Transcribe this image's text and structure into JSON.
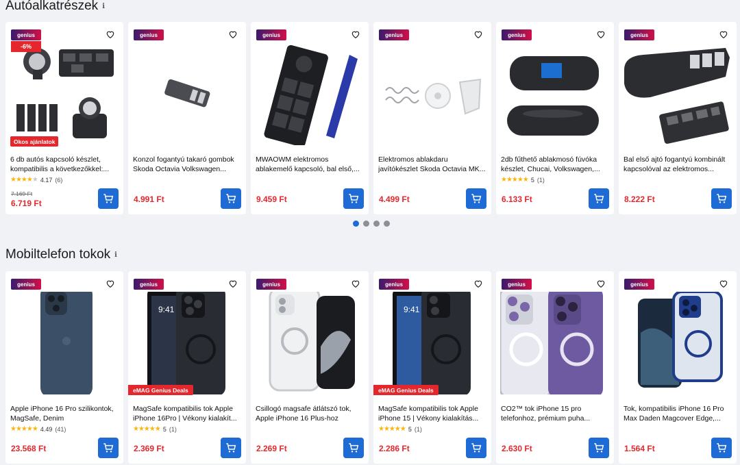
{
  "sections": [
    {
      "title": "Autóalkatrészek",
      "products": [
        {
          "badge": "genius",
          "discount": "-6%",
          "tag": "Okos ajánlatok",
          "title": "6 db autós kapcsoló készlet, kompatibilis a következőkkel:...",
          "stars": 4,
          "rating": "4.17",
          "reviews": "(6)",
          "old_price": "7.169 Ft",
          "price": "6.719 Ft",
          "image": "switch-set"
        },
        {
          "badge": "genius",
          "title": "Konzol fogantyú takaró gombok Skoda Octavia Volkswagen...",
          "price": "4.991 Ft",
          "image": "console-button"
        },
        {
          "badge": "genius",
          "title": "MWAOWM elektromos ablakemelő kapcsoló, bal első,...",
          "price": "9.459 Ft",
          "image": "window-switch"
        },
        {
          "badge": "genius",
          "title": "Elektromos ablakdaru javítókészlet Skoda Octavia MK...",
          "price": "4.499 Ft",
          "image": "repair-kit"
        },
        {
          "badge": "genius",
          "title": "2db fűthető ablakmosó fúvóka készlet, Chucai, Volkswagen,...",
          "stars": 5,
          "rating": "5",
          "reviews": "(1)",
          "price": "6.133 Ft",
          "image": "nozzle"
        },
        {
          "badge": "genius",
          "title": "Bal első ajtó fogantyú kombinált kapcsolóval az elektromos...",
          "price": "8.222 Ft",
          "image": "door-handle"
        }
      ]
    },
    {
      "title": "Mobiltelefon tokok",
      "products": [
        {
          "badge": "genius",
          "title": "Apple iPhone 16 Pro szilikontok, MagSafe, Denim",
          "stars": 4.5,
          "rating": "4.49",
          "reviews": "(41)",
          "price": "23.568 Ft",
          "image": "silicone-case"
        },
        {
          "badge": "genius",
          "tag": "eMAG Genius Deals",
          "title": "MagSafe kompatibilis tok Apple iPhone 16Pro | Vékony kialakít...",
          "stars": 5,
          "rating": "5",
          "reviews": "(1)",
          "price": "2.369 Ft",
          "image": "dark-case"
        },
        {
          "badge": "genius",
          "title": "Csillogó magsafe átlátszó tok, Apple iPhone 16 Plus-hoz",
          "price": "2.269 Ft",
          "image": "clear-case"
        },
        {
          "badge": "genius",
          "tag": "eMAG Genius Deals",
          "title": "MagSafe kompatibilis tok Apple iPhone 15 | Vékony kialakítás...",
          "stars": 5,
          "rating": "5",
          "reviews": "(1)",
          "price": "2.286 Ft",
          "image": "dark-case-15"
        },
        {
          "badge": "genius",
          "title": "CO2™ tok iPhone 15 pro telefonhoz, prémium puha...",
          "price": "2.630 Ft",
          "image": "purple-case"
        },
        {
          "badge": "genius",
          "title": "Tok, kompatibilis iPhone 16 Pro Max Daden Magcover Edge,...",
          "price": "1.564 Ft",
          "image": "blue-edge-case"
        }
      ]
    }
  ],
  "carousel": {
    "pages": 4,
    "active": 1
  }
}
